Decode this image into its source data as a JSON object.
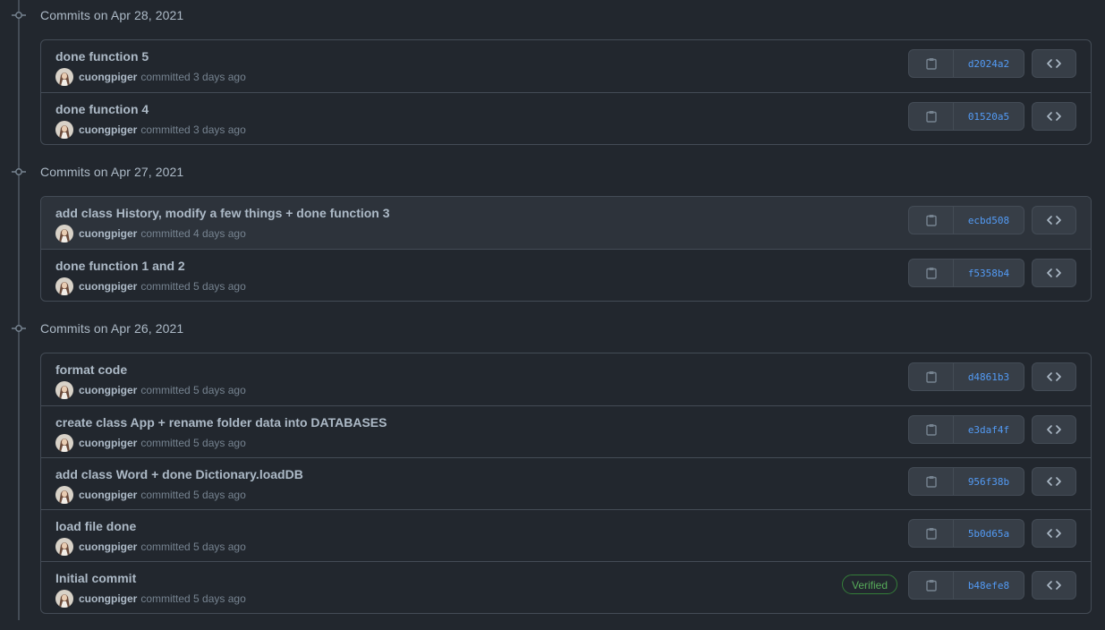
{
  "groups": [
    {
      "title": "Commits on Apr 28, 2021",
      "commits": [
        {
          "message": "done function 5",
          "author": "cuongpiger",
          "time": "committed 3 days ago",
          "sha": "d2024a2",
          "verified": ""
        },
        {
          "message": "done function 4",
          "author": "cuongpiger",
          "time": "committed 3 days ago",
          "sha": "01520a5",
          "verified": ""
        }
      ]
    },
    {
      "title": "Commits on Apr 27, 2021",
      "commits": [
        {
          "message": "add class History, modify a few things + done function 3",
          "author": "cuongpiger",
          "time": "committed 4 days ago",
          "sha": "ecbd508",
          "verified": ""
        },
        {
          "message": "done function 1 and 2",
          "author": "cuongpiger",
          "time": "committed 5 days ago",
          "sha": "f5358b4",
          "verified": ""
        }
      ]
    },
    {
      "title": "Commits on Apr 26, 2021",
      "commits": [
        {
          "message": "format code",
          "author": "cuongpiger",
          "time": "committed 5 days ago",
          "sha": "d4861b3",
          "verified": ""
        },
        {
          "message": "create class App + rename folder data into DATABASES",
          "author": "cuongpiger",
          "time": "committed 5 days ago",
          "sha": "e3daf4f",
          "verified": ""
        },
        {
          "message": "add class Word + done Dictionary.loadDB",
          "author": "cuongpiger",
          "time": "committed 5 days ago",
          "sha": "956f38b",
          "verified": ""
        },
        {
          "message": "load file done",
          "author": "cuongpiger",
          "time": "committed 5 days ago",
          "sha": "5b0d65a",
          "verified": ""
        },
        {
          "message": "Initial commit",
          "author": "cuongpiger",
          "time": "committed 5 days ago",
          "sha": "b48efe8",
          "verified": "Verified"
        }
      ]
    }
  ],
  "icons": {
    "node": "git-commit-icon",
    "copy": "clipboard-icon",
    "browse": "code-icon",
    "avatar": "avatar"
  },
  "colors": {
    "background": "#22272e",
    "border": "#444c56",
    "sha_link": "#539bf5",
    "verified": "#57ab5a",
    "row_hover": "#2d333b"
  }
}
